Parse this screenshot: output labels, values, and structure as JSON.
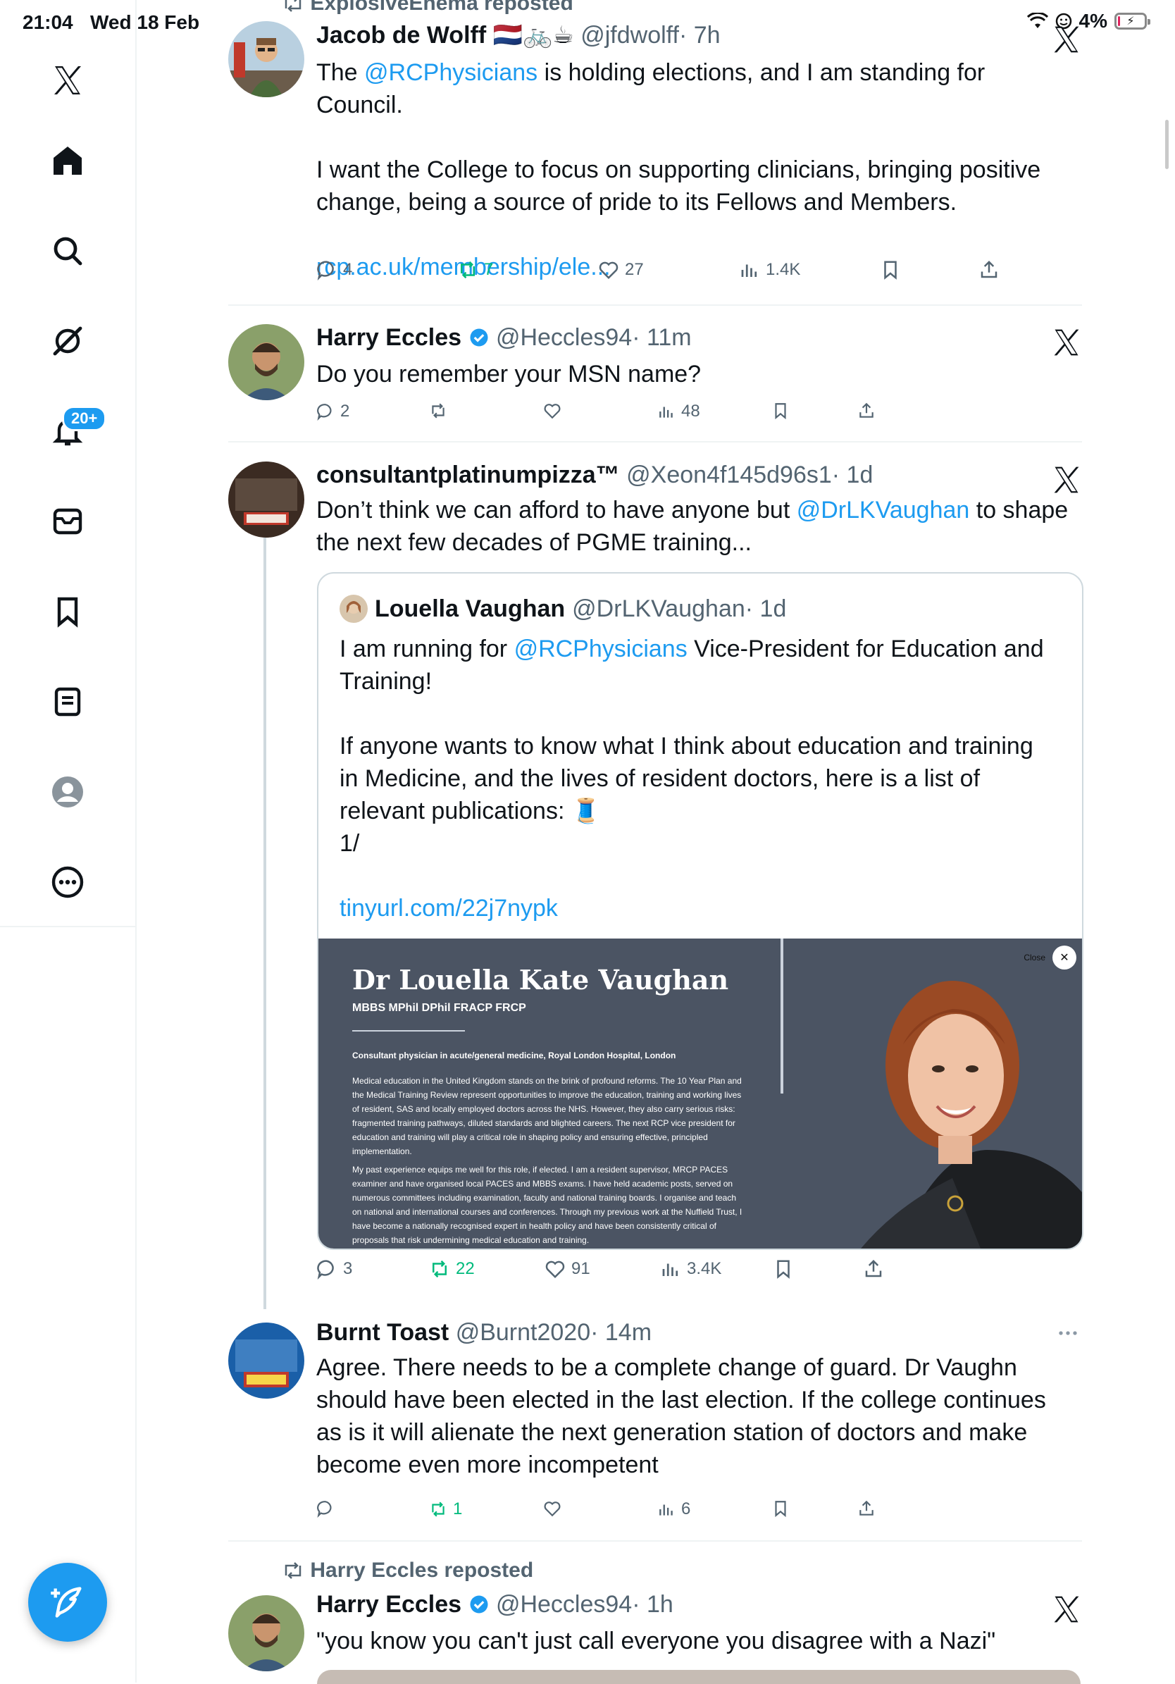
{
  "status_bar": {
    "time": "21:04",
    "date": "Wed 18 Feb",
    "battery": "4%",
    "battery_fraction": 0.04
  },
  "sidebar": {
    "items": [
      "x-logo",
      "home",
      "search",
      "grok",
      "notifications",
      "messages",
      "bookmarks",
      "lists",
      "profile",
      "more"
    ],
    "notifications_badge": "20+"
  },
  "tweets": [
    {
      "repost_by": "ExplosiveEnema reposted",
      "name": "Jacob de Wolff",
      "name_emojis": "🇳🇱🚲☕",
      "handle": "@jfdwolff",
      "time": "· 7h",
      "body_pre": "The ",
      "body_mention": "@RCPhysicians",
      "body_post": " is holding elections, and I am standing for Council.\n\nI want the College to focus on supporting clinicians, bringing positive change, being a source of pride to its Fellows and Members.\n\n",
      "body_link": "rcp.ac.uk/membership/ele...",
      "replies": "4",
      "reposts": "7",
      "likes": "27",
      "views": "1.4K"
    },
    {
      "name": "Harry Eccles",
      "handle": "@Heccles94",
      "time": "· 11m",
      "body": "Do you remember your MSN name?",
      "replies": "2",
      "reposts": "",
      "likes": "",
      "views": "48"
    },
    {
      "name": "consultantplatinumpizza™",
      "handle": "@Xeon4f145d96s1",
      "time": "· 1d",
      "body_pre": "Don’t think we can afford to have anyone but ",
      "body_mention": "@DrLKVaughan",
      "body_post": " to shape the next few decades of PGME training...",
      "replies": "3",
      "reposts": "22",
      "likes": "91",
      "views": "3.4K",
      "quote": {
        "name": "Louella Vaughan",
        "handle": "@DrLKVaughan",
        "time": "· 1d",
        "body_pre": "I am running for ",
        "body_mention": "@RCPhysicians",
        "body_post": " Vice-President for Education and Training!\n\nIf anyone wants to know what I think about education and training in Medicine, and the lives of resident doctors, here is a list of relevant publications: 🧵\n1/\n\n",
        "body_link": "tinyurl.com/22j7nypk",
        "card": {
          "title": "Dr Louella Kate Vaughan",
          "subtitle": "MBBS MPhil DPhil FRACP FRCP",
          "close": "Close",
          "lines": [
            "Consultant physician in acute/general medicine, Royal London Hospital, London",
            "Medical education in the United Kingdom stands on the brink of profound reforms. The 10 Year Plan and",
            "the Medical Training Review represent opportunities to improve the education, training and working lives",
            "of resident, SAS and locally employed doctors across the NHS. However, they also carry serious risks:",
            "fragmented training pathways, diluted standards and blighted careers. The next RCP vice president for",
            "education and training will play a critical role in shaping policy and ensuring effective, principled",
            "implementation.",
            "My past experience equips me well for this role, if elected. I am a resident supervisor, MRCP PACES",
            "examiner and have organised local PACES and MBBS exams. I have held academic posts, served on",
            "numerous committees including examination, faculty and national training boards. I organise and teach",
            "on national and international courses and conferences. Through my previous work at the Nuffield Trust, I",
            "have become a nationally recognised expert in health policy and have been consistently critical of",
            "proposals that risk undermining medical education and training."
          ]
        }
      }
    },
    {
      "name": "Burnt Toast",
      "handle": "@Burnt2020",
      "time": "· 14m",
      "body": "Agree. There needs to be a complete change of guard. Dr Vaughn should have been elected in the last election. If the college continues as is it will alienate the next generation station of doctors and make become even more incompetent",
      "replies": "",
      "reposts": "1",
      "likes": "",
      "views": "6"
    },
    {
      "repost_by": "Harry Eccles reposted",
      "name": "Harry Eccles",
      "handle": "@Heccles94",
      "time": "· 1h",
      "body": "\"you know you can't just call everyone you disagree with a Nazi\""
    }
  ],
  "colors": {
    "accent": "#1d9bf0",
    "repost_green": "#00ba7c",
    "muted": "#536471"
  }
}
